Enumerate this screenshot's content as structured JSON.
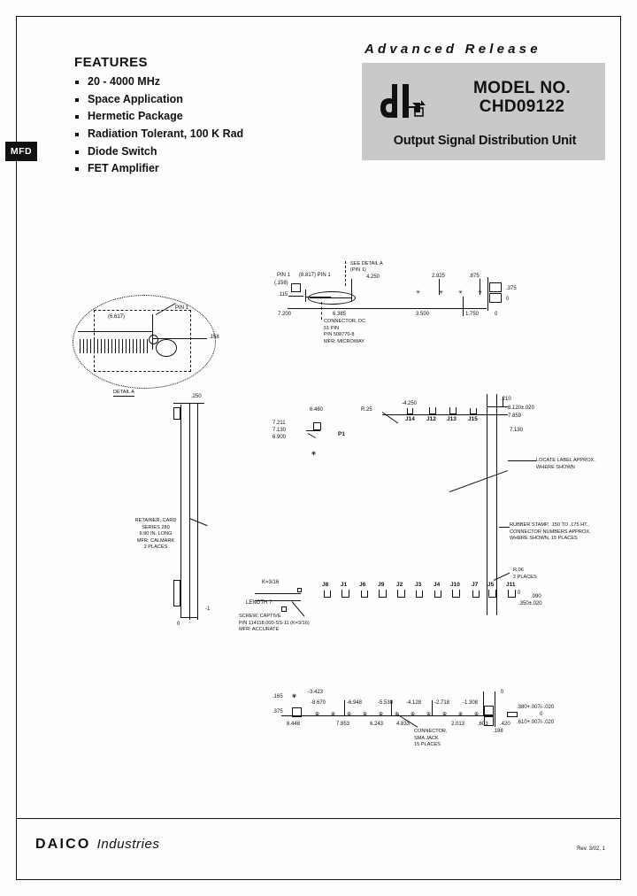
{
  "features": {
    "title": "FEATURES",
    "items": [
      "20 - 4000 MHz",
      "Space Application",
      "Hermetic Package",
      "Radiation Tolerant, 100 K Rad",
      "Diode Switch",
      "FET Amplifier"
    ]
  },
  "side_tab": {
    "label": "MFD"
  },
  "header": {
    "advanced_release": "Advanced Release",
    "model_label": "MODEL NO.",
    "model_number": "CHD09122",
    "subtitle": "Output Signal Distribution Unit",
    "logo_alt": "daico-logo",
    "block_color": "#c9c9c9"
  },
  "drawing": {
    "detail_a": {
      "caption": "DETAIL A",
      "pin1_label": "PIN 1",
      "dim_6617": "(6.617)",
      "dim_158": ".158"
    },
    "top_view": {
      "pin1_left": "PIN 1",
      "dim_158": "(.158)",
      "dim_115": ".115",
      "dim_8817": "(8.817) PIN 1",
      "see_detail": "SEE DETAIL A",
      "see_detail_sub": "(PIN 1)",
      "dim_4250": "4.250",
      "dim_2825": "2.825",
      "dim_875": ".875",
      "dim_375": ".375",
      "dim_0_right": "0",
      "dim_7200": "7.200",
      "dim_6385": "6.385",
      "dim_3500": "3.500",
      "dim_1750": "1.750",
      "dim_0_base": "0",
      "connector_note": "CONNECTOR, DC\n51 PIN\nP/N 508770-8\nMFR: MICROWAY"
    },
    "side_view": {
      "dim_250": ".250",
      "dim_7211": "7.211",
      "dim_7130": "7.130",
      "dim_6900": "6.900",
      "dim_6460": "6.460",
      "p1_label": "P1",
      "r25": "R.25",
      "dim_4250": "-4.250",
      "dim_210": ".210",
      "dim_8120": "8.120±.020",
      "dim_7859": "7.859",
      "dim_7130_r": "7.130",
      "top_j_labels": [
        "J14",
        "J12",
        "J13",
        "J15"
      ],
      "retainer_note": "RETAINER, CARD\nSERIES 280\n6.90 IN. LONG\nMFR: CALMARK\n2 PLACES",
      "locate_label_note": "LOCATE LABEL APPROX.\nWHERE SHOWN",
      "rubber_stamp_note": "RUBBER STAMP, .150 TO .175 HT.,\nCONNECTOR NUMBERS APPROX.\nWHERE SHOWN, 15 PLACES",
      "r06_note": "R.06\n2 PLACES",
      "dim_090": ".090",
      "dim_350": ".350±.020",
      "dim_0_small": "0",
      "k_label": "K=3/16",
      "length_label": "LENGTH ?",
      "screw_note": "SCREW, CAPTIVE\nP/N 114118.000-SS-11 (K=3/16)\nMFR: ACCURATE",
      "bottom_j_labels": [
        "J8",
        "J1",
        "J6",
        "J9",
        "J2",
        "J3",
        "J4",
        "J10",
        "J7",
        "J5",
        "J11"
      ]
    },
    "bottom_view": {
      "dim_165": ".165",
      "dim_375": ".375",
      "dim_8670": "-8.670",
      "dim_6948": "-6.948",
      "dim_5538": "-5.538",
      "dim_4128": "-4.128",
      "dim_3423": "-3.423",
      "dim_2718": "-2.718",
      "dim_1308": "-1.308",
      "dim_0_top": "0",
      "dim_8448": "8.448",
      "dim_7853": "7.853",
      "dim_6243": "6.243",
      "dim_4833": "4.833",
      "dim_2013": "2.013",
      "dim_603": ".603",
      "dim_420": ".420",
      "dim_198": ".198",
      "tol_380": ".380+.007/-.020",
      "tol_610": ".610+.007/-.020",
      "dim_0_right": "0",
      "sma_note": "CONNECTOR,\nSMA JACK\n15 PLACES"
    }
  },
  "footer": {
    "company": "DAICO",
    "company_sub": "Industries",
    "revision": "Rev. 3/02, 1"
  }
}
